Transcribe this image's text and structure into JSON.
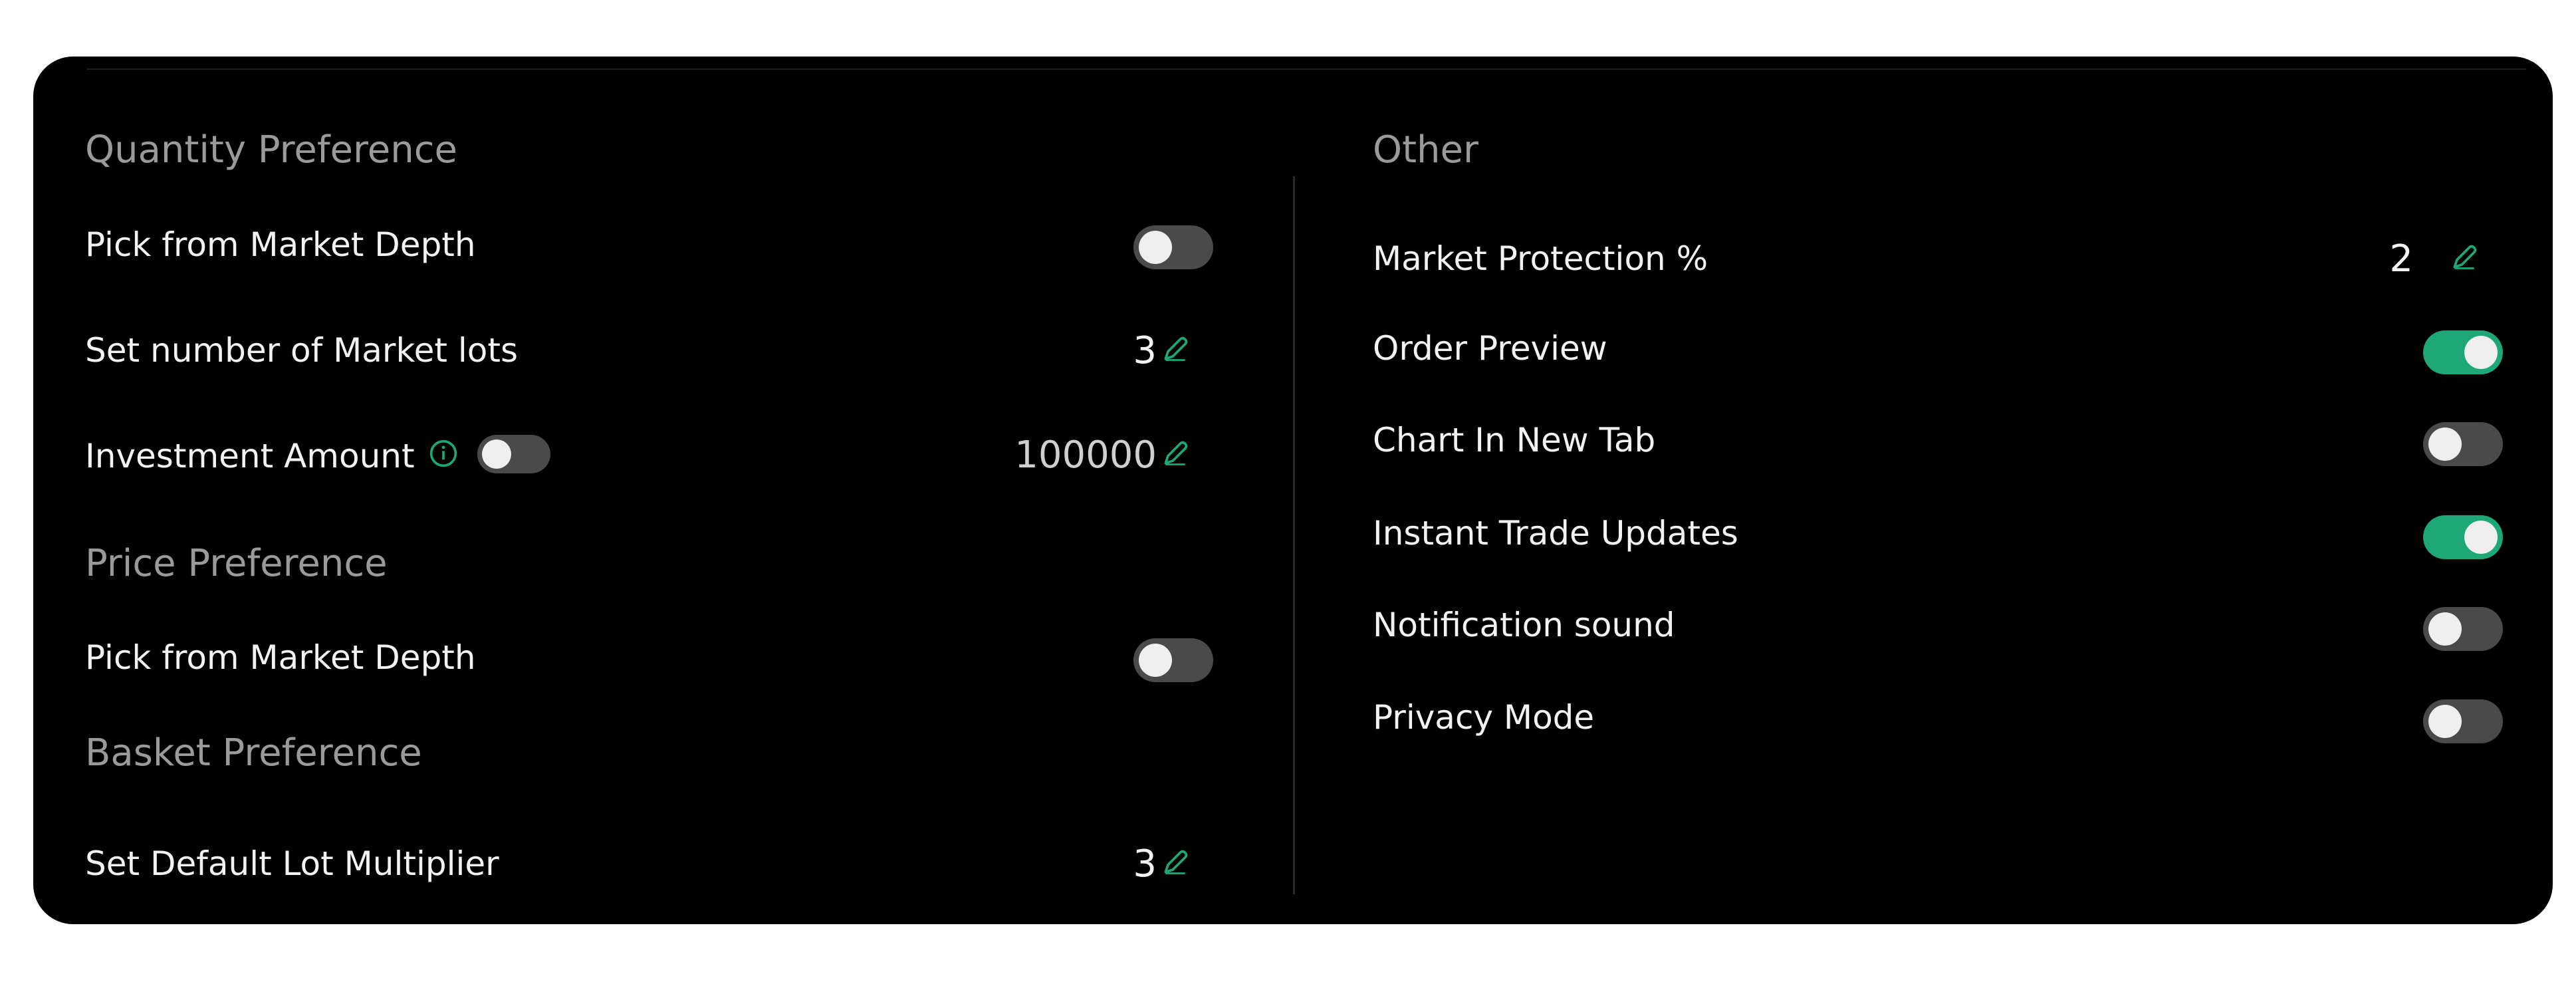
{
  "left": {
    "quantity": {
      "title": "Quantity Preference",
      "pick_depth_label": "Pick from Market Depth",
      "pick_depth_on": false,
      "lots_label": "Set number of Market lots",
      "lots_value": "3",
      "investment_label": "Investment Amount",
      "investment_toggle_on": false,
      "investment_value": "100000"
    },
    "price": {
      "title": "Price Preference",
      "pick_depth_label": "Pick from Market Depth",
      "pick_depth_on": false
    },
    "basket": {
      "title": "Basket Preference",
      "lot_multiplier_label": "Set Default Lot Multiplier",
      "lot_multiplier_value": "3"
    }
  },
  "right": {
    "title": "Other",
    "market_protection_label": "Market Protection %",
    "market_protection_value": "2",
    "order_preview_label": "Order Preview",
    "order_preview_on": true,
    "chart_new_tab_label": "Chart In New Tab",
    "chart_new_tab_on": false,
    "instant_trade_label": "Instant Trade Updates",
    "instant_trade_on": true,
    "notification_sound_label": "Notification sound",
    "notification_sound_on": false,
    "privacy_mode_label": "Privacy Mode",
    "privacy_mode_on": false
  },
  "colors": {
    "accent": "#1fa877",
    "panel_bg": "#000000",
    "toggle_off": "#4a4a4a"
  },
  "icons": {
    "edit": "pencil-icon",
    "info": "info-icon"
  }
}
